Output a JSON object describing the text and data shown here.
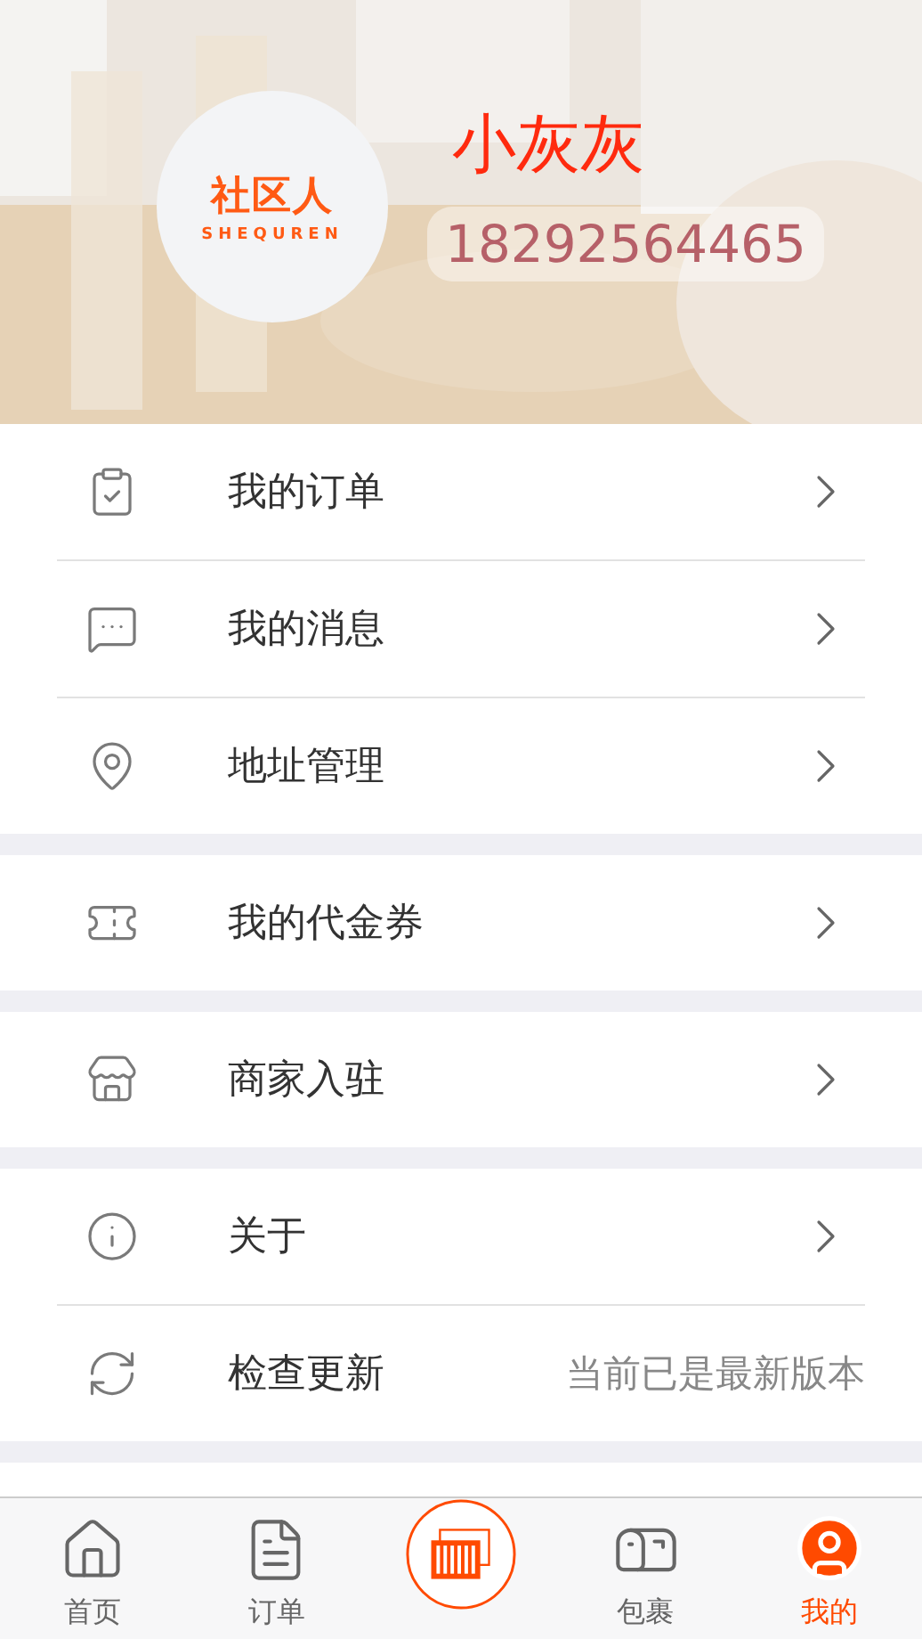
{
  "profile": {
    "logo_text": "社区人",
    "logo_subtext": "SHEQUREN",
    "name": "小灰灰",
    "phone": "18292564465"
  },
  "menu_groups": [
    {
      "items": [
        {
          "kind": "link",
          "label": "我的订单"
        },
        {
          "kind": "link",
          "label": "我的消息"
        },
        {
          "kind": "link",
          "label": "地址管理"
        }
      ]
    },
    {
      "items": [
        {
          "kind": "link",
          "label": "我的代金券"
        }
      ]
    },
    {
      "items": [
        {
          "kind": "link",
          "label": "商家入驻"
        }
      ]
    },
    {
      "items": [
        {
          "kind": "link",
          "label": "关于"
        },
        {
          "kind": "status",
          "label": "检查更新",
          "value": "当前已是最新版本"
        }
      ]
    }
  ],
  "tab_bar": [
    {
      "label": "首页",
      "selected": false
    },
    {
      "label": "订单",
      "selected": false
    },
    {
      "kind": "scan",
      "selected": false
    },
    {
      "label": "包裹",
      "selected": false
    },
    {
      "label": "我的",
      "selected": true
    }
  ]
}
